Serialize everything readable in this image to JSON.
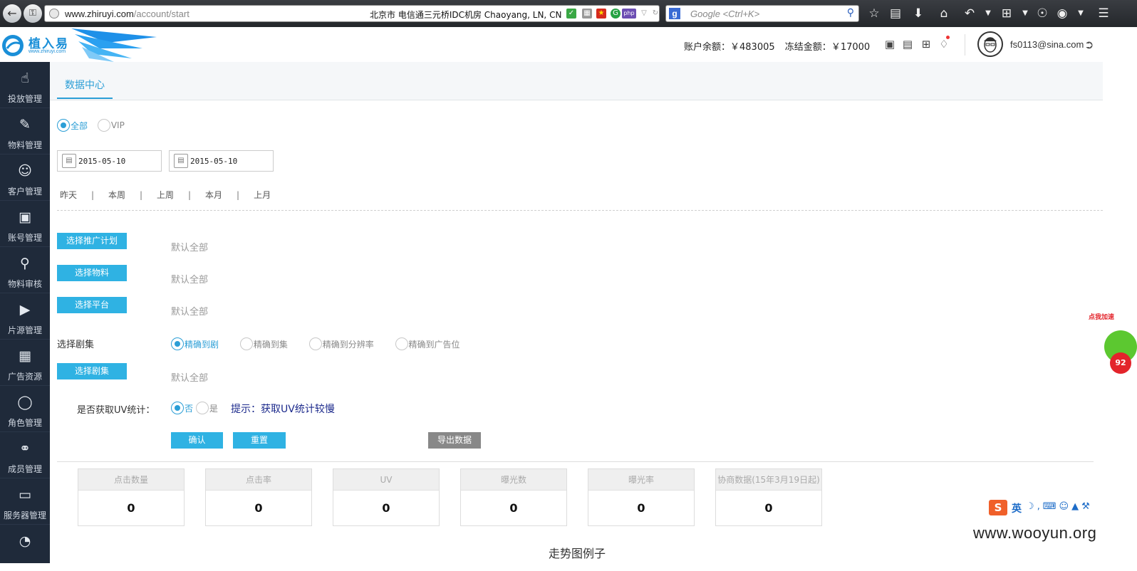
{
  "browser": {
    "url_host": "www.zhiruyi.com",
    "url_path": "/account/start",
    "geo": "北京市 电信通三元桥IDC机房   Chaoyang, LN, CN",
    "search_placeholder": "Google <Ctrl+K>",
    "search_engine": "g"
  },
  "header": {
    "logo_text": "植入易",
    "logo_sub": "www.zhiruyi.com",
    "balance_label": "账户余额：",
    "balance_value": "￥483005",
    "frozen_label": "冻结金额：",
    "frozen_value": "￥17000",
    "user_email": "fs0113@sina.com"
  },
  "sidebar": {
    "items": [
      {
        "label": "投放管理",
        "icon": "hand-icon"
      },
      {
        "label": "物料管理",
        "icon": "edit-icon"
      },
      {
        "label": "客户管理",
        "icon": "customer-icon"
      },
      {
        "label": "账号管理",
        "icon": "lock-icon"
      },
      {
        "label": "物料审核",
        "icon": "search-doc-icon"
      },
      {
        "label": "片源管理",
        "icon": "film-icon"
      },
      {
        "label": "广告资源",
        "icon": "image-icon"
      },
      {
        "label": "角色管理",
        "icon": "person-icon"
      },
      {
        "label": "成员管理",
        "icon": "group-icon"
      },
      {
        "label": "服务器管理",
        "icon": "monitor-icon"
      }
    ]
  },
  "main": {
    "tab": "数据中心",
    "scope": {
      "all": "全部",
      "vip": "VIP"
    },
    "date_start": "2015-05-10",
    "date_end": "2015-05-10",
    "quick_ranges": [
      "昨天",
      "本周",
      "上周",
      "本月",
      "上月"
    ],
    "select_plan": "选择推广计划",
    "select_material": "选择物料",
    "select_platform": "选择平台",
    "default_all": "默认全部",
    "series_label": "选择剧集",
    "series_options": [
      "精确到剧",
      "精确到集",
      "精确到分辨率",
      "精确到广告位"
    ],
    "select_series": "选择剧集",
    "uv_label": "是否获取UV统计：",
    "uv_no": "否",
    "uv_yes": "是",
    "uv_tip": "提示：获取UV统计较慢",
    "confirm": "确认",
    "reset": "重置",
    "export": "导出数据",
    "stats": [
      {
        "label": "点击数量",
        "value": "0"
      },
      {
        "label": "点击率",
        "value": "0"
      },
      {
        "label": "UV",
        "value": "0"
      },
      {
        "label": "曝光数",
        "value": "0"
      },
      {
        "label": "曝光率",
        "value": "0"
      },
      {
        "label": "协商数据(15年3月19日起)",
        "value": "0"
      }
    ],
    "trend_title": "走势图例子"
  },
  "overlays": {
    "addon_label": "点我加速",
    "addon_number": "92",
    "ime_logo": "S",
    "ime_lang": "英",
    "watermark": "www.wooyun.org"
  },
  "colors": {
    "accent": "#2fb2e3",
    "sidebar": "#1f2a3a",
    "tip": "#1c2a8c"
  }
}
